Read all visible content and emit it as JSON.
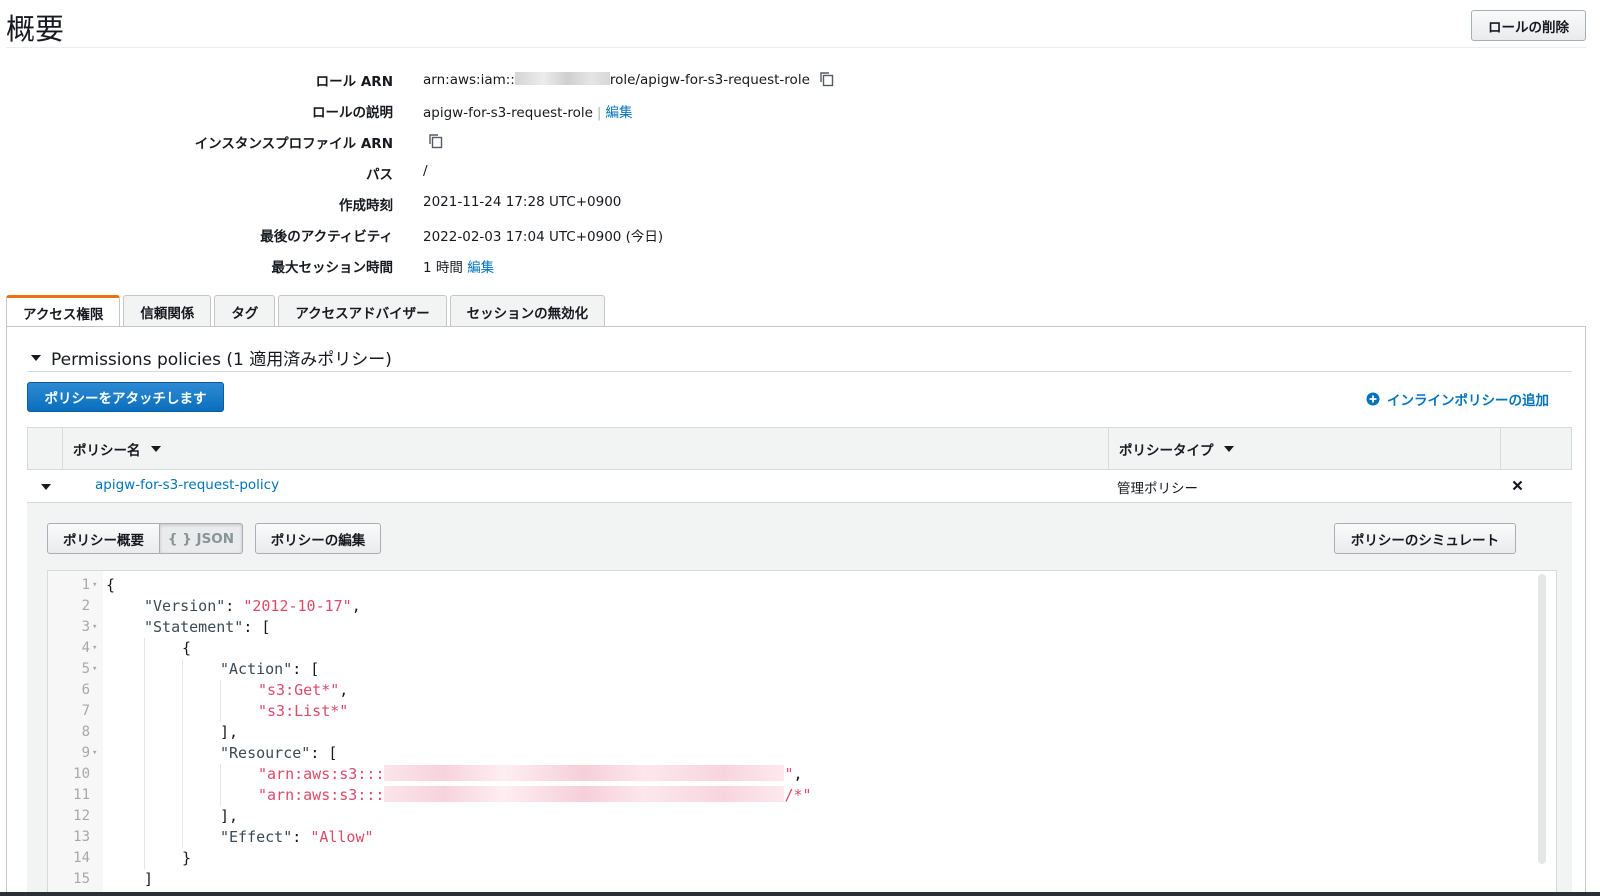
{
  "page": {
    "title": "概要",
    "delete_role_label": "ロールの削除"
  },
  "summary": {
    "role_arn": {
      "label": "ロール ARN",
      "value_prefix": "arn:aws:iam::",
      "value_suffix": "role/apigw-for-s3-request-role"
    },
    "role_description": {
      "label": "ロールの説明",
      "value": "apigw-for-s3-request-role",
      "edit_label": "編集"
    },
    "instance_profile_arn": {
      "label": "インスタンスプロファイル ARN"
    },
    "path": {
      "label": "パス",
      "value": "/"
    },
    "created_at": {
      "label": "作成時刻",
      "value": "2021-11-24 17:28 UTC+0900"
    },
    "last_activity": {
      "label": "最後のアクティビティ",
      "value": "2022-02-03 17:04 UTC+0900 (今日)"
    },
    "max_session": {
      "label": "最大セッション時間",
      "value": "1 時間",
      "edit_label": "編集"
    }
  },
  "tabs": [
    {
      "label": "アクセス権限",
      "active": true
    },
    {
      "label": "信頼関係",
      "active": false
    },
    {
      "label": "タグ",
      "active": false
    },
    {
      "label": "アクセスアドバイザー",
      "active": false
    },
    {
      "label": "セッションの無効化",
      "active": false
    }
  ],
  "permissions": {
    "section_title": "Permissions policies (1 適用済みポリシー)",
    "attach_button": "ポリシーをアタッチします",
    "add_inline": "インラインポリシーの追加",
    "columns": {
      "policy_name": "ポリシー名",
      "policy_type": "ポリシータイプ"
    },
    "rows": [
      {
        "name": "apigw-for-s3-request-policy",
        "type": "管理ポリシー"
      }
    ],
    "detail": {
      "summary_button": "ポリシー概要",
      "json_button": "{ } JSON",
      "edit_button": "ポリシーの編集",
      "simulate_button": "ポリシーのシミュレート"
    }
  },
  "json_editor": {
    "lines": [
      {
        "n": "1",
        "fold": true,
        "text": "{"
      },
      {
        "n": "2",
        "fold": false,
        "key": "\"Version\"",
        "rest": ": ",
        "str": "\"2012-10-17\"",
        "tail": ",",
        "indent": 1
      },
      {
        "n": "3",
        "fold": true,
        "key": "\"Statement\"",
        "rest": ": [",
        "indent": 1
      },
      {
        "n": "4",
        "fold": true,
        "text": "{",
        "indent": 2
      },
      {
        "n": "5",
        "fold": true,
        "key": "\"Action\"",
        "rest": ": [",
        "indent": 3
      },
      {
        "n": "6",
        "fold": false,
        "str": "\"s3:Get*\"",
        "tail": ",",
        "indent": 4
      },
      {
        "n": "7",
        "fold": false,
        "str": "\"s3:List*\"",
        "indent": 4
      },
      {
        "n": "8",
        "fold": false,
        "text": "],",
        "indent": 3
      },
      {
        "n": "9",
        "fold": true,
        "key": "\"Resource\"",
        "rest": ": [",
        "indent": 3
      },
      {
        "n": "10",
        "fold": false,
        "str": "\"arn:aws:s3:::",
        "redact": true,
        "str2": "\"",
        "tail": ",",
        "indent": 4
      },
      {
        "n": "11",
        "fold": false,
        "str": "\"arn:aws:s3:::",
        "redact": true,
        "str2": "/*\"",
        "indent": 4
      },
      {
        "n": "12",
        "fold": false,
        "text": "],",
        "indent": 3
      },
      {
        "n": "13",
        "fold": false,
        "key": "\"Effect\"",
        "rest": ": ",
        "str": "\"Allow\"",
        "indent": 3
      },
      {
        "n": "14",
        "fold": false,
        "text": "}",
        "indent": 2
      },
      {
        "n": "15",
        "fold": false,
        "text": "]",
        "indent": 1
      }
    ]
  },
  "colors": {
    "accent": "#0073bb",
    "primary_button": "#0b6fbd",
    "tab_active_border": "#ec7211",
    "json_string": "#dd4a68"
  }
}
